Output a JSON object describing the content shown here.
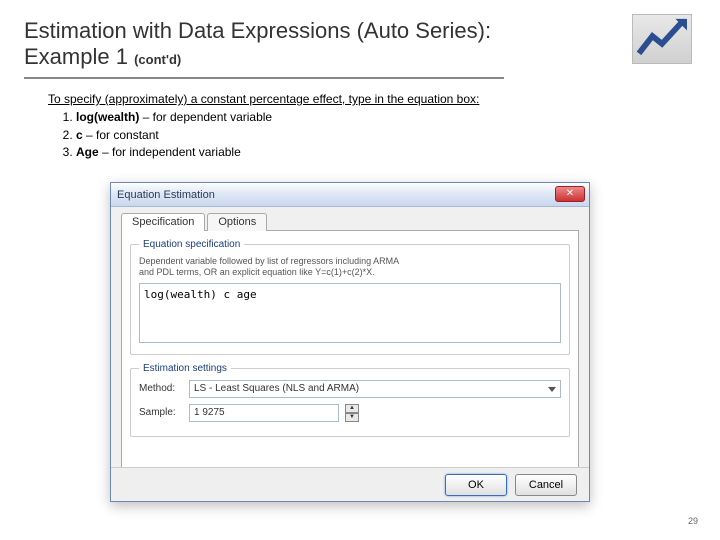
{
  "slide": {
    "title": "Estimation with Data Expressions (Auto Series): Example 1",
    "contd": "(cont'd)",
    "intro": "To specify (approximately) a constant percentage effect, type in the equation box:",
    "items": [
      {
        "term": "log(wealth)",
        "desc": " – for  dependent variable"
      },
      {
        "term": "c",
        "desc": " – for constant"
      },
      {
        "term": "Age",
        "desc": " – for independent variable"
      }
    ],
    "page": "29"
  },
  "dialog": {
    "title": "Equation Estimation",
    "close": "✕",
    "tabs": {
      "spec": "Specification",
      "options": "Options"
    },
    "eqspec": {
      "legend": "Equation specification",
      "hint1": "Dependent variable followed by list of regressors including ARMA",
      "hint2": "and PDL terms, OR an explicit equation like Y=c(1)+c(2)*X.",
      "value": "log(wealth) c age"
    },
    "est": {
      "legend": "Estimation settings",
      "method_label": "Method:",
      "method_value": "LS - Least Squares (NLS and ARMA)",
      "sample_label": "Sample:",
      "sample_value": "1 9275"
    },
    "buttons": {
      "ok": "OK",
      "cancel": "Cancel"
    }
  }
}
